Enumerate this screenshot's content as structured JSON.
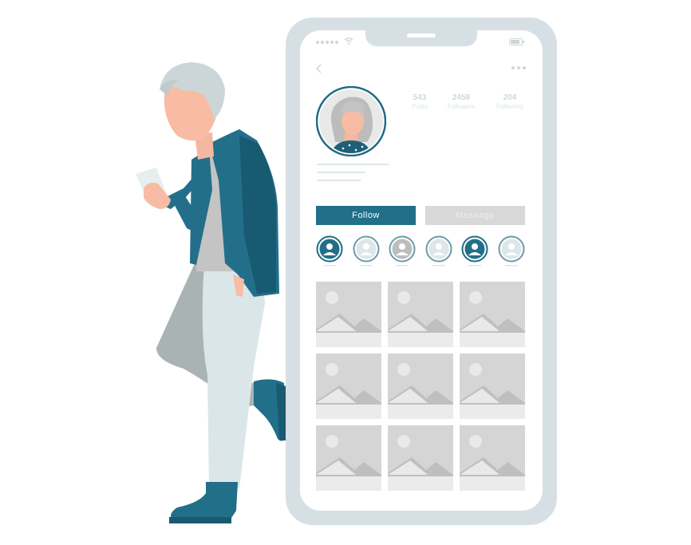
{
  "profile": {
    "stats": [
      {
        "value": "543",
        "label": "Posts"
      },
      {
        "value": "2458",
        "label": "Followers"
      },
      {
        "value": "204",
        "label": "Following"
      }
    ]
  },
  "actions": {
    "follow_label": "Follow",
    "message_label": "Message"
  },
  "stories": [
    {
      "style": "dark"
    },
    {
      "style": "light"
    },
    {
      "style": "gray"
    },
    {
      "style": "light"
    },
    {
      "style": "dark"
    },
    {
      "style": "light"
    }
  ],
  "grid": {
    "rows": 3,
    "cols": 3
  },
  "colors": {
    "accent": "#216f89",
    "phone_frame": "#d6e0e4",
    "placeholder": "#d5d5d5",
    "jacket": "#2a7a93",
    "skin": "#f7bca3"
  },
  "icons": [
    "back-chevron-icon",
    "more-dots-icon",
    "signal-icon",
    "wifi-icon",
    "battery-icon",
    "image-placeholder-icon",
    "user-icon"
  ]
}
